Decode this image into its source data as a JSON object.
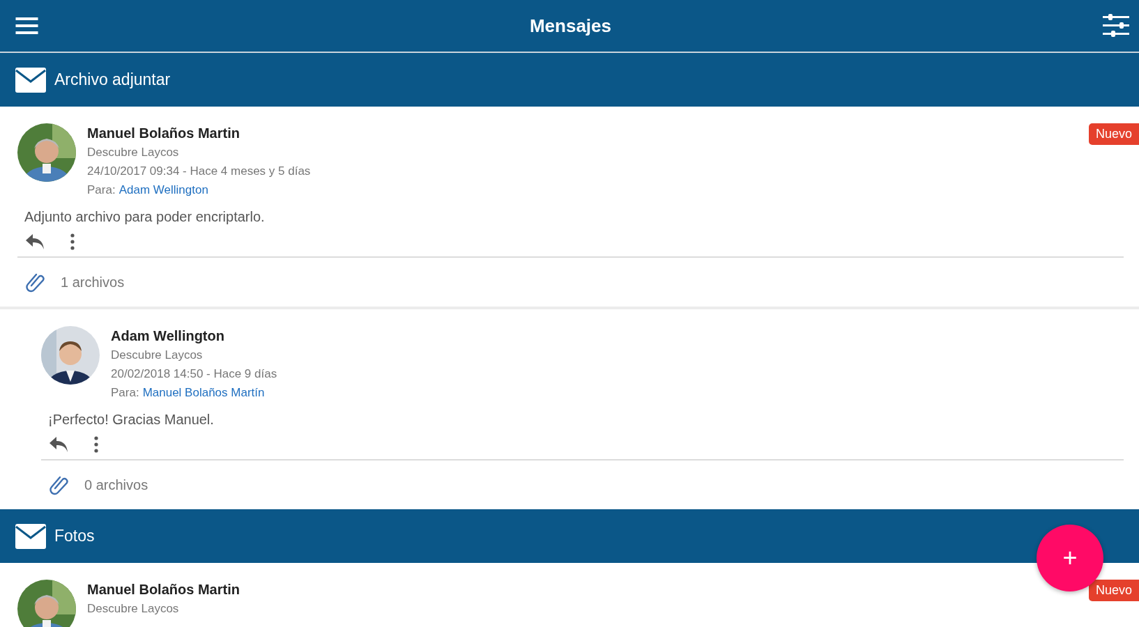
{
  "app_bar": {
    "title": "Mensajes"
  },
  "threads": [
    {
      "subject": "Archivo adjuntar",
      "messages": [
        {
          "sender": "Manuel Bolaños Martin",
          "subject": "Descubre Laycos",
          "date": "24/10/2017 09:34 - Hace 4 meses y 5 días",
          "to_label": "Para:",
          "to": "Adam Wellington",
          "badge": "Nuevo",
          "body": "Adjunto archivo para poder encriptarlo.",
          "attachments": "1 archivos",
          "avatar": {
            "kind": "picture"
          },
          "children": [
            {
              "sender": "Adam Wellington",
              "subject": "Descubre Laycos",
              "date": "20/02/2018 14:50 - Hace 9 días",
              "to_label": "Para:",
              "to": "Manuel Bolaños Martín",
              "body": "¡Perfecto! Gracias Manuel.",
              "attachments": "0 archivos",
              "avatar": {
                "kind": "picture"
              }
            }
          ]
        }
      ]
    },
    {
      "subject": "Fotos",
      "messages": [
        {
          "sender": "Manuel Bolaños Martin",
          "subject": "Descubre Laycos",
          "badge": "Nuevo",
          "avatar": {
            "kind": "picture"
          }
        }
      ]
    }
  ],
  "fab": {
    "label": "+"
  }
}
